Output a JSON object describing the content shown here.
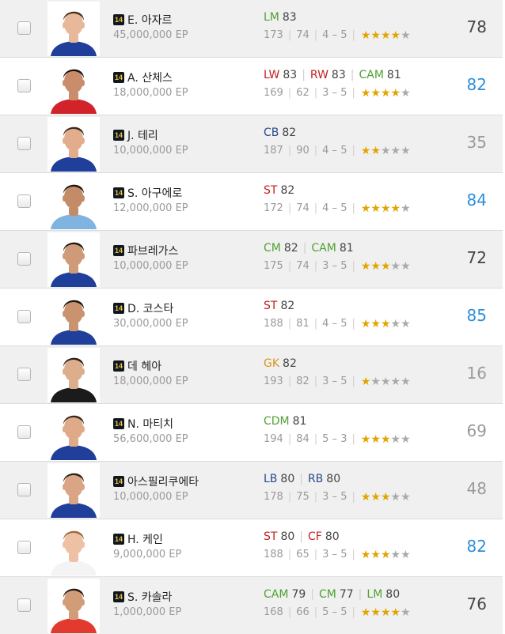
{
  "colors": {
    "fw": "#c41e1e",
    "mf": "#4fa132",
    "df": "#28498c",
    "gk": "#d8951a",
    "score_default": "#444444",
    "score_highlight": "#2d8fdb",
    "score_muted": "#9a9a9a",
    "star_on": "#e2a400",
    "star_off": "#aaaaaa"
  },
  "players": [
    {
      "season_badge": "14",
      "name": "E. 아자르",
      "price": "45,000,000 EP",
      "positions": [
        {
          "pos": "LM",
          "rating": "83",
          "type": "mf"
        }
      ],
      "height": "173",
      "weight": "74",
      "skill": "4 – 5",
      "stars": 4,
      "score": "78",
      "score_style": "default",
      "photo": {
        "skin": "#e7b89a",
        "hair": "#4a2e1a",
        "shirt": "#1f3f9a",
        "bg": "#ffffff"
      }
    },
    {
      "season_badge": "14",
      "name": "A. 산체스",
      "price": "18,000,000 EP",
      "positions": [
        {
          "pos": "LW",
          "rating": "83",
          "type": "fw"
        },
        {
          "pos": "RW",
          "rating": "83",
          "type": "fw"
        },
        {
          "pos": "CAM",
          "rating": "81",
          "type": "mf"
        }
      ],
      "height": "169",
      "weight": "62",
      "skill": "3 – 5",
      "stars": 4,
      "score": "82",
      "score_style": "highlight",
      "photo": {
        "skin": "#c98d6b",
        "hair": "#161210",
        "shirt": "#d2232a",
        "bg": "#ffffff"
      }
    },
    {
      "season_badge": "14",
      "name": "J. 테리",
      "price": "10,000,000 EP",
      "positions": [
        {
          "pos": "CB",
          "rating": "82",
          "type": "df"
        }
      ],
      "height": "187",
      "weight": "90",
      "skill": "4 – 5",
      "stars": 2,
      "score": "35",
      "score_style": "muted",
      "photo": {
        "skin": "#e2ad8c",
        "hair": "#3d2a1c",
        "shirt": "#1f3f9a",
        "bg": "#ffffff"
      }
    },
    {
      "season_badge": "14",
      "name": "S. 아구에로",
      "price": "12,000,000 EP",
      "positions": [
        {
          "pos": "ST",
          "rating": "82",
          "type": "fw"
        }
      ],
      "height": "172",
      "weight": "74",
      "skill": "4 – 5",
      "stars": 4,
      "score": "84",
      "score_style": "highlight",
      "photo": {
        "skin": "#c48b68",
        "hair": "#1c1612",
        "shirt": "#7fb3e0",
        "bg": "#ffffff"
      }
    },
    {
      "season_badge": "14",
      "name": "파브레가스",
      "price": "10,000,000 EP",
      "positions": [
        {
          "pos": "CM",
          "rating": "82",
          "type": "mf"
        },
        {
          "pos": "CAM",
          "rating": "81",
          "type": "mf"
        }
      ],
      "height": "175",
      "weight": "74",
      "skill": "3 – 5",
      "stars": 3,
      "score": "72",
      "score_style": "default",
      "photo": {
        "skin": "#cf9a78",
        "hair": "#241a14",
        "shirt": "#1f3f9a",
        "bg": "#ffffff"
      }
    },
    {
      "season_badge": "14",
      "name": "D. 코스타",
      "price": "30,000,000 EP",
      "positions": [
        {
          "pos": "ST",
          "rating": "82",
          "type": "fw"
        }
      ],
      "height": "188",
      "weight": "81",
      "skill": "4 – 5",
      "stars": 3,
      "score": "85",
      "score_style": "highlight",
      "photo": {
        "skin": "#c9936f",
        "hair": "#1a1410",
        "shirt": "#1f3f9a",
        "bg": "#ffffff"
      }
    },
    {
      "season_badge": "14",
      "name": "데 헤아",
      "price": "18,000,000 EP",
      "positions": [
        {
          "pos": "GK",
          "rating": "82",
          "type": "gk"
        }
      ],
      "height": "193",
      "weight": "82",
      "skill": "3 – 5",
      "stars": 1,
      "score": "16",
      "score_style": "muted",
      "photo": {
        "skin": "#dcae8c",
        "hair": "#2c2018",
        "shirt": "#1b1b1b",
        "bg": "#ffffff"
      }
    },
    {
      "season_badge": "14",
      "name": "N. 마티치",
      "price": "56,600,000 EP",
      "positions": [
        {
          "pos": "CDM",
          "rating": "81",
          "type": "mf"
        }
      ],
      "height": "194",
      "weight": "84",
      "skill": "5 – 3",
      "stars": 3,
      "score": "69",
      "score_style": "muted",
      "photo": {
        "skin": "#deaa88",
        "hair": "#3a281b",
        "shirt": "#1f3f9a",
        "bg": "#ffffff"
      }
    },
    {
      "season_badge": "14",
      "name": "아스필리쿠에타",
      "price": "10,000,000 EP",
      "positions": [
        {
          "pos": "LB",
          "rating": "80",
          "type": "df"
        },
        {
          "pos": "RB",
          "rating": "80",
          "type": "df"
        }
      ],
      "height": "178",
      "weight": "75",
      "skill": "3 – 5",
      "stars": 3,
      "score": "48",
      "score_style": "muted",
      "photo": {
        "skin": "#d9a584",
        "hair": "#2e2218",
        "shirt": "#1f3f9a",
        "bg": "#ffffff"
      }
    },
    {
      "season_badge": "14",
      "name": "H. 케인",
      "price": "9,000,000 EP",
      "positions": [
        {
          "pos": "ST",
          "rating": "80",
          "type": "fw"
        },
        {
          "pos": "CF",
          "rating": "80",
          "type": "fw"
        }
      ],
      "height": "188",
      "weight": "65",
      "skill": "3 – 5",
      "stars": 3,
      "score": "82",
      "score_style": "highlight",
      "photo": {
        "skin": "#eec0a4",
        "hair": "#9a6a3a",
        "shirt": "#f4f4f4",
        "bg": "#ffffff"
      }
    },
    {
      "season_badge": "14",
      "name": "S. 카솔라",
      "price": "1,000,000 EP",
      "positions": [
        {
          "pos": "CAM",
          "rating": "79",
          "type": "mf"
        },
        {
          "pos": "CM",
          "rating": "77",
          "type": "mf"
        },
        {
          "pos": "LM",
          "rating": "80",
          "type": "mf"
        }
      ],
      "height": "168",
      "weight": "66",
      "skill": "5 – 5",
      "stars": 4,
      "score": "76",
      "score_style": "default",
      "photo": {
        "skin": "#d19d79",
        "hair": "#221912",
        "shirt": "#e23a2e",
        "bg": "#ffffff"
      }
    }
  ]
}
